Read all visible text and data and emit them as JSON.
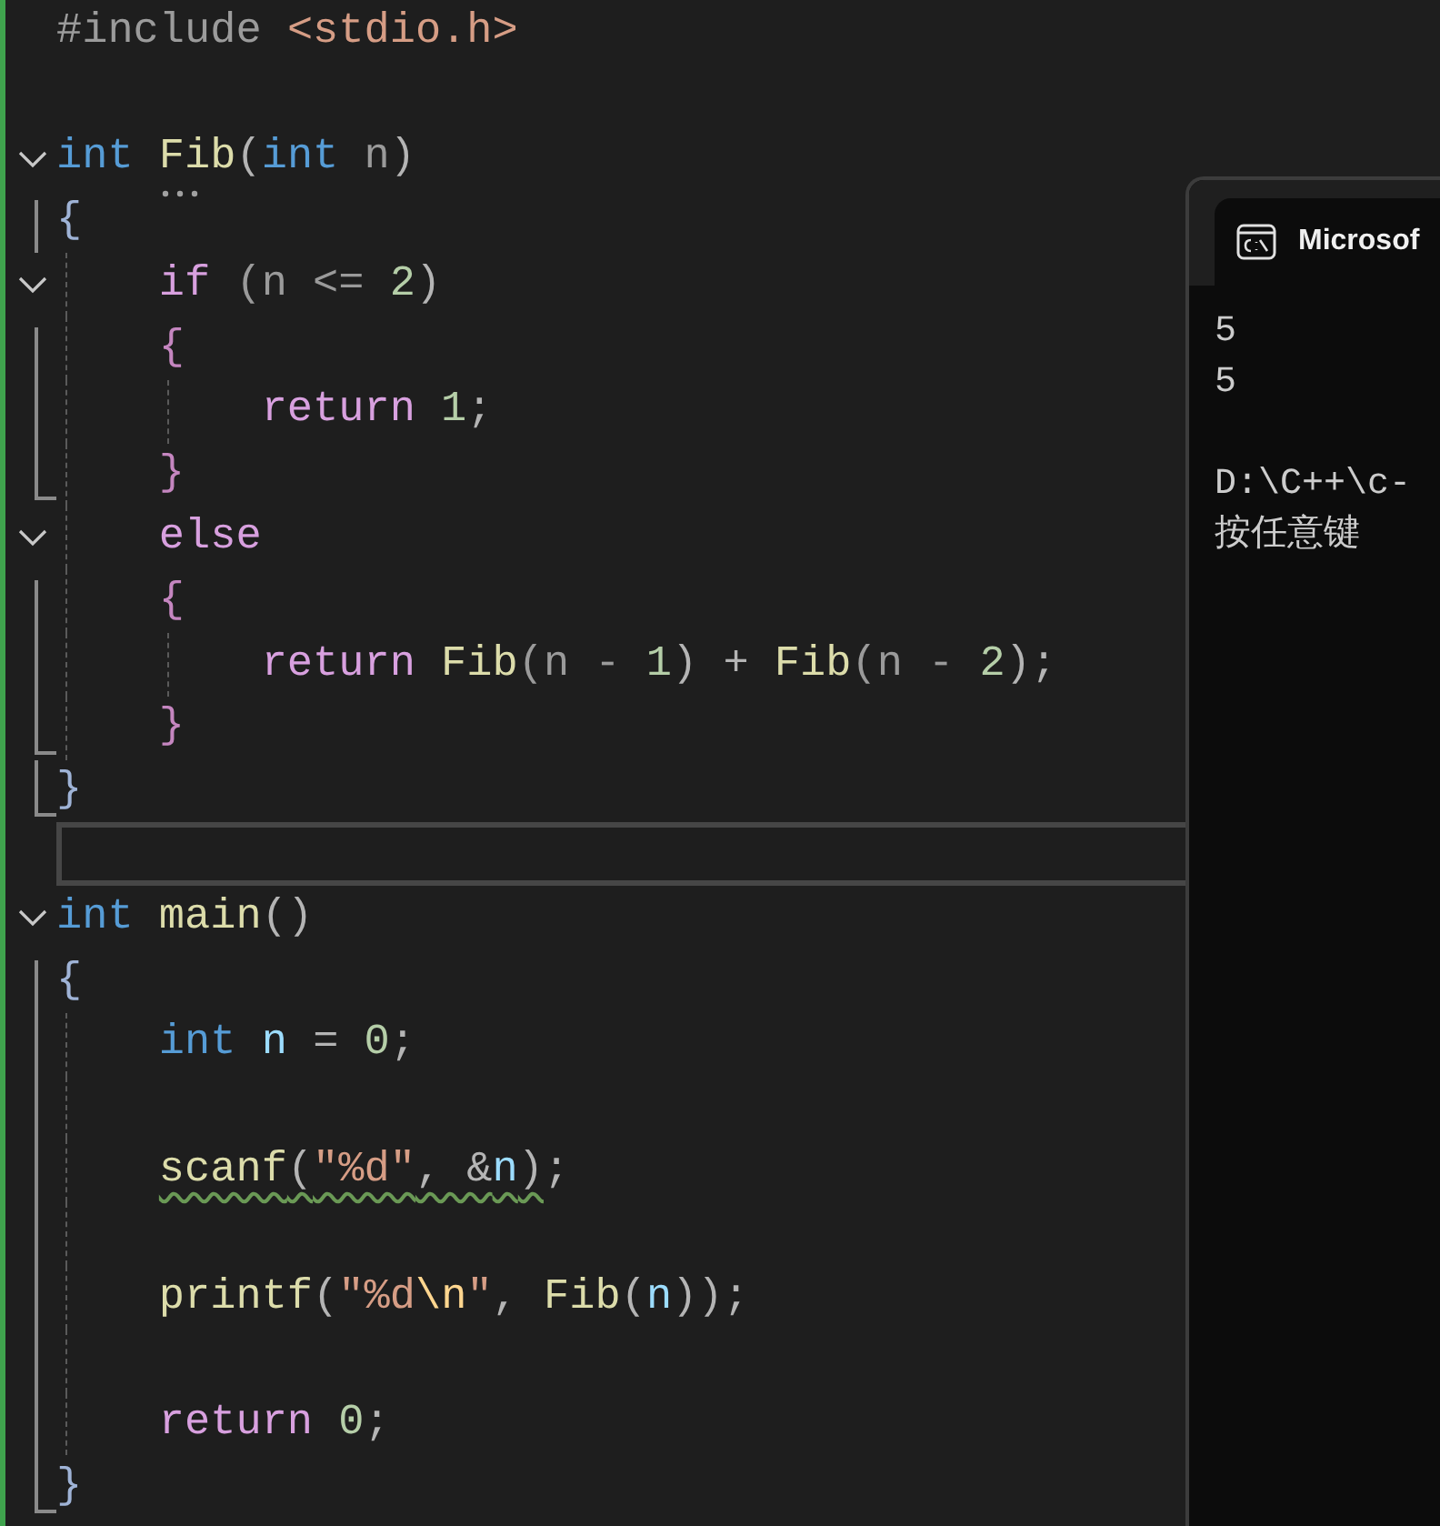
{
  "editor": {
    "lines": [
      {
        "kind": "code",
        "tokens": [
          {
            "text": "#include",
            "kind": "preprocessor"
          },
          {
            "text": " <stdio.h>",
            "kind": "include"
          }
        ]
      },
      {
        "kind": "blank"
      },
      {
        "kind": "code",
        "folded": false,
        "tokens": [
          {
            "text": "int ",
            "kind": "keyword"
          },
          {
            "text": "Fib",
            "kind": "function",
            "hint": true
          },
          {
            "text": "(",
            "kind": "punct"
          },
          {
            "text": "int",
            "kind": "keyword"
          },
          {
            "text": " n",
            "kind": "param"
          },
          {
            "text": ")",
            "kind": "punct"
          }
        ]
      },
      {
        "kind": "code",
        "tokens": [
          {
            "text": "{",
            "kind": "brace"
          }
        ]
      },
      {
        "kind": "code",
        "folded": false,
        "tokens": [
          {
            "text": "    if",
            "kind": "control"
          },
          {
            "text": " (n <= ",
            "kind": "param"
          },
          {
            "text": "2",
            "kind": "number"
          },
          {
            "text": ")",
            "kind": "punct"
          }
        ]
      },
      {
        "kind": "code",
        "tokens": [
          {
            "text": "    {",
            "kind": "brace2"
          }
        ]
      },
      {
        "kind": "code",
        "tokens": [
          {
            "text": "        return ",
            "kind": "control"
          },
          {
            "text": "1",
            "kind": "number"
          },
          {
            "text": ";",
            "kind": "punct"
          }
        ]
      },
      {
        "kind": "code",
        "tokens": [
          {
            "text": "    }",
            "kind": "brace2"
          }
        ]
      },
      {
        "kind": "code",
        "folded": false,
        "tokens": [
          {
            "text": "    else",
            "kind": "control"
          }
        ]
      },
      {
        "kind": "code",
        "tokens": [
          {
            "text": "    {",
            "kind": "brace2"
          }
        ]
      },
      {
        "kind": "code",
        "tokens": [
          {
            "text": "        return ",
            "kind": "control"
          },
          {
            "text": "Fib",
            "kind": "function"
          },
          {
            "text": "(n - ",
            "kind": "param"
          },
          {
            "text": "1",
            "kind": "number"
          },
          {
            "text": ")",
            "kind": "punct"
          },
          {
            "text": " + ",
            "kind": "punct"
          },
          {
            "text": "Fib",
            "kind": "function"
          },
          {
            "text": "(n - ",
            "kind": "param"
          },
          {
            "text": "2",
            "kind": "number"
          },
          {
            "text": ");",
            "kind": "punct"
          }
        ]
      },
      {
        "kind": "code",
        "tokens": [
          {
            "text": "    }",
            "kind": "brace2"
          }
        ]
      },
      {
        "kind": "code",
        "tokens": [
          {
            "text": "}",
            "kind": "brace"
          }
        ]
      },
      {
        "kind": "blank",
        "current": true
      },
      {
        "kind": "code",
        "folded": false,
        "tokens": [
          {
            "text": "int ",
            "kind": "keyword"
          },
          {
            "text": "main",
            "kind": "function"
          },
          {
            "text": "()",
            "kind": "punct"
          }
        ]
      },
      {
        "kind": "code",
        "tokens": [
          {
            "text": "{",
            "kind": "brace"
          }
        ]
      },
      {
        "kind": "code",
        "tokens": [
          {
            "text": "    int ",
            "kind": "keyword"
          },
          {
            "text": "n",
            "kind": "variable"
          },
          {
            "text": " = ",
            "kind": "punct"
          },
          {
            "text": "0",
            "kind": "number"
          },
          {
            "text": ";",
            "kind": "punct"
          }
        ]
      },
      {
        "kind": "blank"
      },
      {
        "kind": "code",
        "tokens": [
          {
            "text": "    scanf",
            "kind": "function",
            "squiggle": true
          },
          {
            "text": "(",
            "kind": "punct",
            "squiggle": true
          },
          {
            "text": "\"%d\"",
            "kind": "string",
            "squiggle": true
          },
          {
            "text": ", &",
            "kind": "punct",
            "squiggle": true
          },
          {
            "text": "n",
            "kind": "variable",
            "squiggle": true
          },
          {
            "text": ")",
            "kind": "punct",
            "squiggle": true
          },
          {
            "text": ";",
            "kind": "punct"
          }
        ]
      },
      {
        "kind": "blank"
      },
      {
        "kind": "code",
        "tokens": [
          {
            "text": "    printf",
            "kind": "function"
          },
          {
            "text": "(",
            "kind": "punct"
          },
          {
            "text": "\"%d",
            "kind": "string"
          },
          {
            "text": "\\n",
            "kind": "escape"
          },
          {
            "text": "\"",
            "kind": "string"
          },
          {
            "text": ", ",
            "kind": "punct"
          },
          {
            "text": "Fib",
            "kind": "function"
          },
          {
            "text": "(",
            "kind": "punct"
          },
          {
            "text": "n",
            "kind": "variable"
          },
          {
            "text": "));",
            "kind": "punct"
          }
        ]
      },
      {
        "kind": "blank"
      },
      {
        "kind": "code",
        "tokens": [
          {
            "text": "    return ",
            "kind": "control"
          },
          {
            "text": "0",
            "kind": "number"
          },
          {
            "text": ";",
            "kind": "punct"
          }
        ]
      },
      {
        "kind": "code",
        "tokens": [
          {
            "text": "}",
            "kind": "brace"
          }
        ]
      }
    ]
  },
  "console": {
    "tab_title": "Microsof",
    "output": [
      {
        "text": "5"
      },
      {
        "text": "5"
      },
      {
        "text": "D:\\C++\\c-",
        "gap_before": true
      },
      {
        "text": "按任意键"
      }
    ]
  }
}
